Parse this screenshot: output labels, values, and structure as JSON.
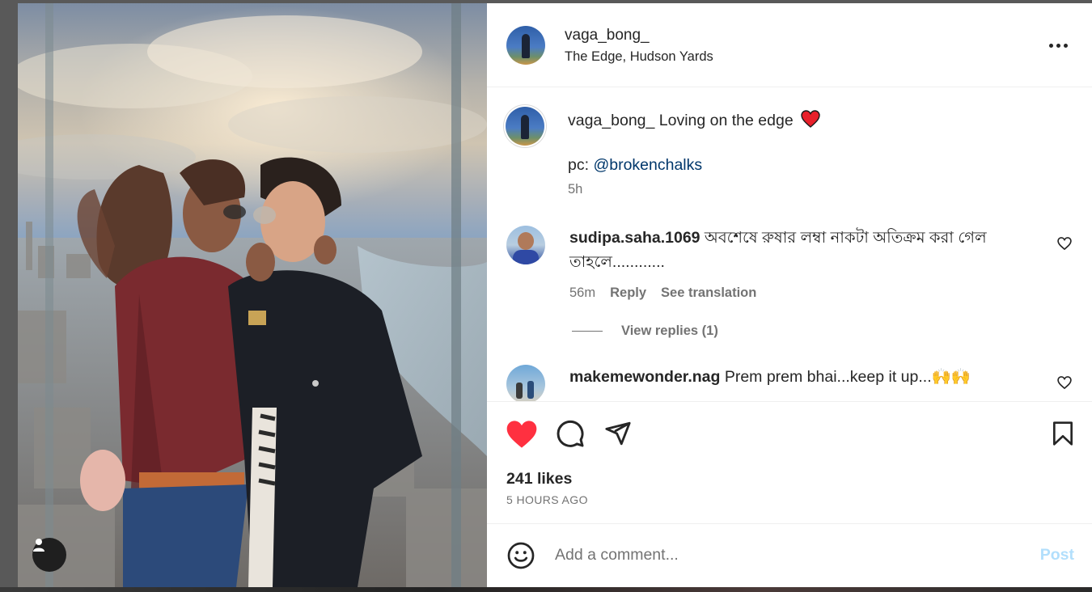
{
  "post": {
    "username": "vaga_bong_",
    "location": "The Edge, Hudson Yards",
    "caption_text": " Loving on the edge",
    "caption_emoji": "❤️",
    "caption_line2_prefix": "pc: ",
    "caption_mention": "@brokenchalks",
    "caption_time": "5h",
    "likes": "241 likes",
    "posted_ago": "5 HOURS AGO"
  },
  "comments": [
    {
      "username": "sudipa.saha.1069",
      "text": " অবশেষে রুষার লম্বা নাকটা অতিক্রম করা গেল তাহলে............",
      "time": "56m",
      "reply_label": "Reply",
      "translate_label": "See translation",
      "view_replies": "View replies (1)"
    },
    {
      "username": "makemewonder.nag",
      "text": " Prem prem bhai...keep it up...🙌🙌"
    }
  ],
  "comment_box": {
    "placeholder": "Add a comment...",
    "post_label": "Post"
  },
  "icons": {
    "like": "heart-filled-icon",
    "comment": "comment-bubble-icon",
    "share": "paper-plane-icon",
    "save": "bookmark-icon",
    "emoji": "smiley-icon",
    "more": "more-horizontal-icon"
  },
  "colors": {
    "like_red": "#ff3040",
    "mention_blue": "#00376b",
    "post_disabled": "#b2dffc",
    "secondary_text": "#737373"
  }
}
